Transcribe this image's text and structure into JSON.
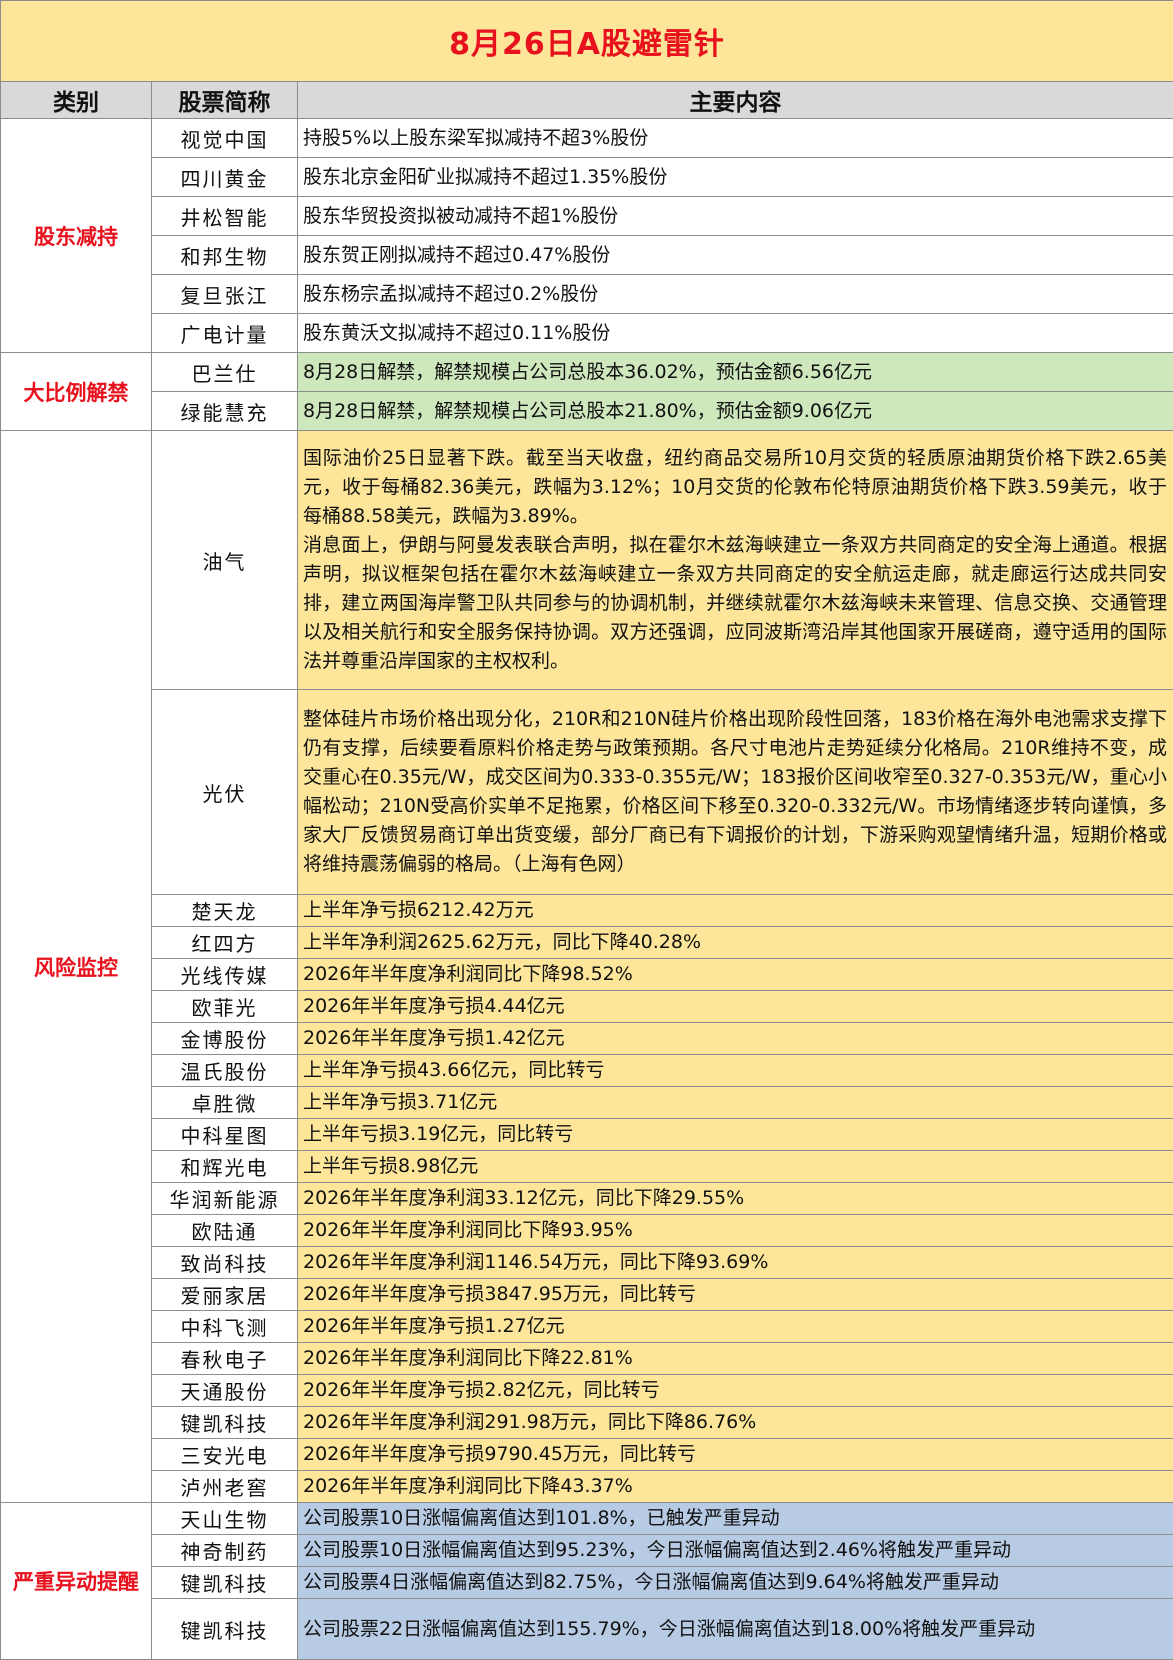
{
  "title": "8月26日A股避雷针",
  "headers": {
    "category": "类别",
    "stock": "股票简称",
    "content": "主要内容"
  },
  "sections": [
    {
      "category": "股东减持",
      "rows": [
        {
          "stock": "视觉中国",
          "content": "持股5%以上股东梁军拟减持不超3%股份"
        },
        {
          "stock": "四川黄金",
          "content": "股东北京金阳矿业拟减持不超过1.35%股份"
        },
        {
          "stock": "井松智能",
          "content": "股东华贸投资拟被动减持不超1%股份"
        },
        {
          "stock": "和邦生物",
          "content": "股东贺正刚拟减持不超过0.47%股份"
        },
        {
          "stock": "复旦张江",
          "content": "股东杨宗孟拟减持不超过0.2%股份"
        },
        {
          "stock": "广电计量",
          "content": "股东黄沃文拟减持不超过0.11%股份"
        }
      ]
    },
    {
      "category": "大比例解禁",
      "rows": [
        {
          "stock": "巴兰仕",
          "content": "8月28日解禁，解禁规模占公司总股本36.02%，预估金额6.56亿元"
        },
        {
          "stock": "绿能慧充",
          "content": "8月28日解禁，解禁规模占公司总股本21.80%，预估金额9.06亿元"
        }
      ]
    },
    {
      "category": "风险监控",
      "long_rows": [
        {
          "stock": "油气",
          "paragraphs": [
            "国际油价25日显著下跌。截至当天收盘，纽约商品交易所10月交货的轻质原油期货价格下跌2.65美元，收于每桶82.36美元，跌幅为3.12%；10月交货的伦敦布伦特原油期货价格下跌3.59美元，收于每桶88.58美元，跌幅为3.89%。",
            "消息面上，伊朗与阿曼发表联合声明，拟在霍尔木兹海峡建立一条双方共同商定的安全海上通道。根据声明，拟议框架包括在霍尔木兹海峡建立一条双方共同商定的安全航运走廊，就走廊运行达成共同安排，建立两国海岸警卫队共同参与的协调机制，并继续就霍尔木兹海峡未来管理、信息交换、交通管理以及相关航行和安全服务保持协调。双方还强调，应同波斯湾沿岸其他国家开展磋商，遵守适用的国际法并尊重沿岸国家的主权权利。"
          ]
        },
        {
          "stock": "光伏",
          "paragraphs": [
            "整体硅片市场价格出现分化，210R和210N硅片价格出现阶段性回落，183价格在海外电池需求支撑下仍有支撑，后续要看原料价格走势与政策预期。各尺寸电池片走势延续分化格局。210R维持不变，成交重心在0.35元/W，成交区间为0.333-0.355元/W；183报价区间收窄至0.327-0.353元/W，重心小幅松动；210N受高价实单不足拖累，价格区间下移至0.320-0.332元/W。市场情绪逐步转向谨慎，多家大厂反馈贸易商订单出货变缓，部分厂商已有下调报价的计划，下游采购观望情绪升温，短期价格或将维持震荡偏弱的格局。（上海有色网）"
          ]
        }
      ],
      "rows": [
        {
          "stock": "楚天龙",
          "content": "上半年净亏损6212.42万元"
        },
        {
          "stock": "红四方",
          "content": "上半年净利润2625.62万元，同比下降40.28%"
        },
        {
          "stock": "光线传媒",
          "content": "2026年半年度净利润同比下降98.52%"
        },
        {
          "stock": "欧菲光",
          "content": "2026年半年度净亏损4.44亿元"
        },
        {
          "stock": "金博股份",
          "content": "2026年半年度净亏损1.42亿元"
        },
        {
          "stock": "温氏股份",
          "content": "上半年净亏损43.66亿元，同比转亏"
        },
        {
          "stock": "卓胜微",
          "content": "上半年净亏损3.71亿元"
        },
        {
          "stock": "中科星图",
          "content": "上半年亏损3.19亿元，同比转亏"
        },
        {
          "stock": "和辉光电",
          "content": "上半年亏损8.98亿元"
        },
        {
          "stock": "华润新能源",
          "content": "2026年半年度净利润33.12亿元，同比下降29.55%"
        },
        {
          "stock": "欧陆通",
          "content": "2026年半年度净利润同比下降93.95%"
        },
        {
          "stock": "致尚科技",
          "content": "2026年半年度净利润1146.54万元，同比下降93.69%"
        },
        {
          "stock": "爱丽家居",
          "content": "2026年半年度净亏损3847.95万元，同比转亏"
        },
        {
          "stock": "中科飞测",
          "content": "2026年半年度净亏损1.27亿元"
        },
        {
          "stock": "春秋电子",
          "content": "2026年半年度净利润同比下降22.81%"
        },
        {
          "stock": "天通股份",
          "content": "2026年半年度净亏损2.82亿元，同比转亏"
        },
        {
          "stock": "键凯科技",
          "content": "2026年半年度净利润291.98万元，同比下降86.76%"
        },
        {
          "stock": "三安光电",
          "content": "2026年半年度净亏损9790.45万元，同比转亏"
        },
        {
          "stock": "泸州老窖",
          "content": "2026年半年度净利润同比下降43.37%"
        }
      ]
    },
    {
      "category": "严重异动提醒",
      "rows": [
        {
          "stock": "天山生物",
          "content": "公司股票10日涨幅偏离值达到101.8%，已触发严重异动"
        },
        {
          "stock": "神奇制药",
          "content": "公司股票10日涨幅偏离值达到95.23%，今日涨幅偏离值达到2.46%将触发严重异动"
        },
        {
          "stock": "键凯科技",
          "content": "公司股票4日涨幅偏离值达到82.75%，今日涨幅偏离值达到9.64%将触发严重异动"
        },
        {
          "stock": "键凯科技",
          "content": "公司股票22日涨幅偏离值达到155.79%，今日涨幅偏离值达到18.00%将触发严重异动"
        }
      ]
    }
  ]
}
